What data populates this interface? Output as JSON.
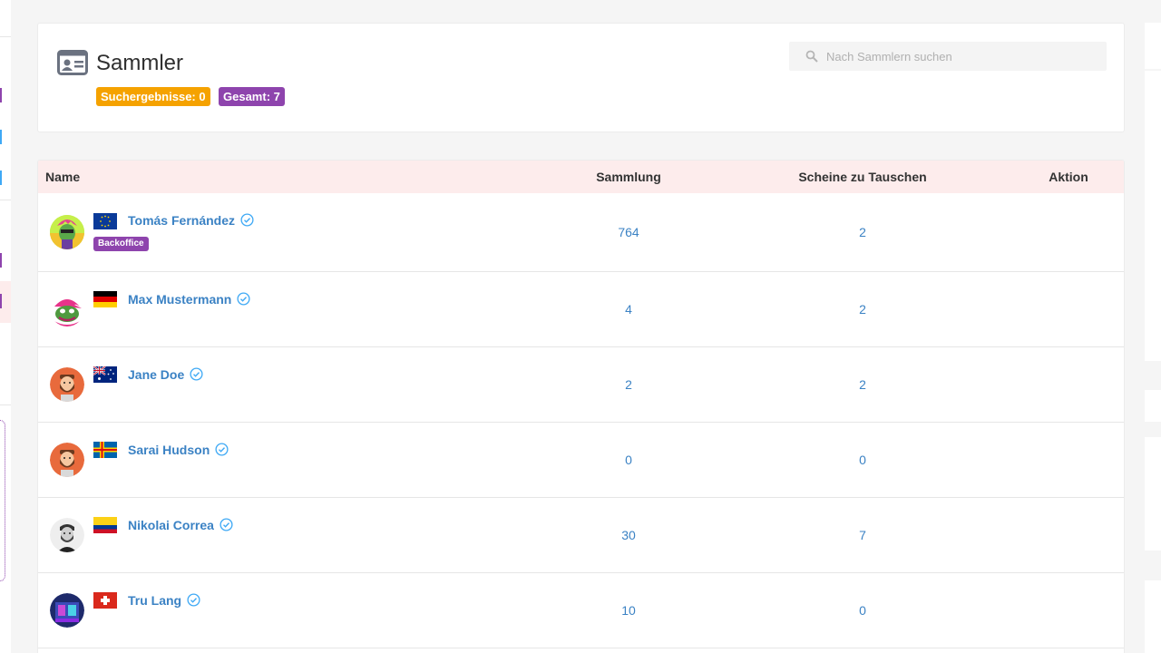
{
  "page": {
    "title": "Sammler",
    "badges": {
      "results": "Suchergebnisse: 0",
      "total": "Gesamt: 7"
    },
    "search": {
      "placeholder": "Nach Sammlern suchen",
      "value": ""
    }
  },
  "colors": {
    "accent_link": "#3b82c4",
    "badge_orange": "#f5a200",
    "badge_purple": "#8e44ad",
    "header_row": "#fdecec",
    "verified": "#3fa9f5"
  },
  "table": {
    "columns": {
      "name": "Name",
      "collection": "Sammlung",
      "trade": "Scheine zu Tauschen",
      "action": "Aktion"
    },
    "rows": [
      {
        "name": "Tomás Fernández",
        "flag": "eu-flag",
        "avatar": "pepe-punk-avatar",
        "role": "Backoffice",
        "collection": "764",
        "trade": "2"
      },
      {
        "name": "Max Mustermann",
        "flag": "germany-flag",
        "avatar": "pepe-pink-avatar",
        "collection": "4",
        "trade": "2"
      },
      {
        "name": "Jane Doe",
        "flag": "australia-flag",
        "avatar": "bearded-man-avatar",
        "collection": "2",
        "trade": "2"
      },
      {
        "name": "Sarai Hudson",
        "flag": "aland-flag",
        "avatar": "bearded-man-avatar",
        "collection": "0",
        "trade": "0"
      },
      {
        "name": "Nikolai Correa",
        "flag": "colombia-flag",
        "avatar": "photo-avatar",
        "collection": "30",
        "trade": "7"
      },
      {
        "name": "Tru Lang",
        "flag": "switzerland-flag",
        "avatar": "neon-avatar",
        "collection": "10",
        "trade": "0"
      }
    ]
  }
}
